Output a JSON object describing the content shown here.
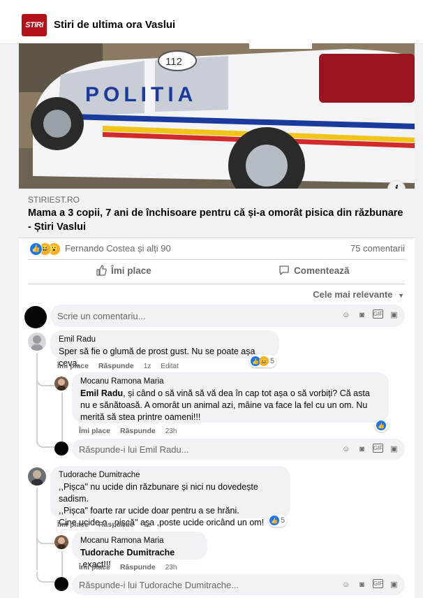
{
  "page": {
    "name": "Stiri de ultima ora Vaslui",
    "logo_text": "STIRI"
  },
  "post": {
    "photo_plate": "112",
    "photo_text": "POLITIA",
    "link_domain": "STIRIEST.RO",
    "link_title": "Mama a 3 copii, 7 ani de închisoare pentru că și-a omorât pisica din răzbunare - Știri Vaslui",
    "reactions_text": "Fernando Costea și alți 90",
    "comments_count": "75 comentarii",
    "like_label": "Îmi place",
    "comment_label": "Comentează",
    "sort_label": "Cele mai relevante"
  },
  "composer": {
    "placeholder": "Scrie un comentariu..."
  },
  "comments": [
    {
      "author": "Emil Radu",
      "text": "Sper să fie o glumă de prost gust. Nu se poate așa ceva.",
      "like": "Îmi place",
      "reply": "Răspunde",
      "time": "1z",
      "edited": "Editat",
      "reactions": "5",
      "replies": [
        {
          "author": "Mocanu Ramona Maria",
          "mention": "Emil Radu",
          "text": ", și când o să vină să vă dea în cap tot așa o să vorbiți? Că asta nu e sănătoasă. A omorât un animal azi, mâine va face la fel cu un om. Nu merită să stea printre oameni!!!",
          "like": "Îmi place",
          "reply": "Răspunde",
          "time": "23h"
        }
      ],
      "reply_placeholder": "Răspunde-i lui Emil Radu..."
    },
    {
      "author": "Tudorache Dumitrache",
      "lines": [
        ",,Pișca\" nu ucide din răzbunare și nici nu dovedește sadism.",
        ",,Pișca\" foarte rar ucide doar pentru a se hrăni.",
        "Cine ucide o ,,pișcă\" așa ,poste ucide oricând un om!"
      ],
      "like": "Îmi place",
      "reply": "Răspunde",
      "time": "1z",
      "reactions": "5",
      "replies": [
        {
          "author": "Mocanu Ramona Maria",
          "mention": "Tudorache Dumitrache",
          "text": " ,exact!!!",
          "like": "Îmi place",
          "reply": "Răspunde",
          "time": "23h"
        }
      ],
      "reply_placeholder": "Răspunde-i lui Tudorache Dumitrache..."
    }
  ],
  "colors": {
    "like_blue": "#1877f2",
    "text_secondary": "#65676b",
    "bubble": "#f0f2f5",
    "logo_red": "#b3121a"
  },
  "icons": [
    "like-icon",
    "haha-icon",
    "wow-icon",
    "thumbs-up-icon",
    "comment-icon",
    "chevron-down-icon",
    "emoji-icon",
    "camera-icon",
    "gif-icon",
    "sticker-icon",
    "info-icon"
  ]
}
